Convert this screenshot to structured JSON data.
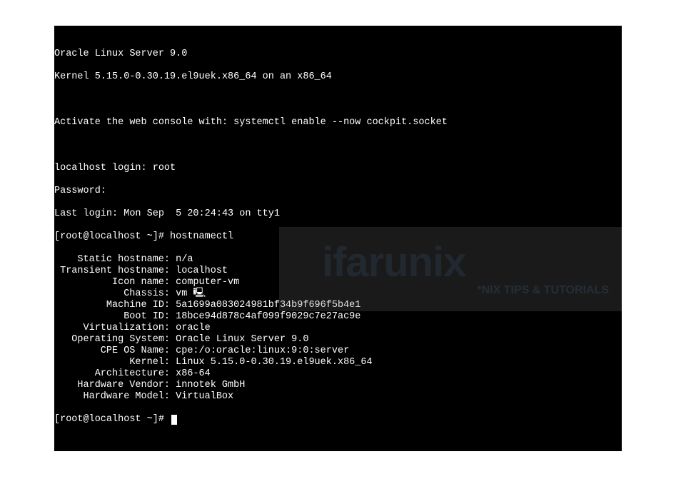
{
  "banner": {
    "line1": "Oracle Linux Server 9.0",
    "line2": "Kernel 5.15.0-0.30.19.el9uek.x86_64 on an x86_64",
    "activate": "Activate the web console with: systemctl enable --now cockpit.socket"
  },
  "login": {
    "prompt_label": "localhost login: ",
    "username": "root",
    "password_label": "Password:",
    "last_login": "Last login: Mon Sep  5 20:24:43 on tty1"
  },
  "shell": {
    "prompt1": "[root@localhost ~]# ",
    "command1": "hostnamectl",
    "prompt2": "[root@localhost ~]# "
  },
  "hostnamectl": [
    {
      "label": "Static hostname",
      "value": "n/a"
    },
    {
      "label": "Transient hostname",
      "value": "localhost"
    },
    {
      "label": "Icon name",
      "value": "computer-vm"
    },
    {
      "label": "Chassis",
      "value": "vm 🖳"
    },
    {
      "label": "Machine ID",
      "value": "5a1699a083024981bf34b9f696f5b4e1"
    },
    {
      "label": "Boot ID",
      "value": "18bce94d878c4af099f9029c7e27ac9e"
    },
    {
      "label": "Virtualization",
      "value": "oracle"
    },
    {
      "label": "Operating System",
      "value": "Oracle Linux Server 9.0"
    },
    {
      "label": "CPE OS Name",
      "value": "cpe:/o:oracle:linux:9:0:server"
    },
    {
      "label": "Kernel",
      "value": "Linux 5.15.0-0.30.19.el9uek.x86_64"
    },
    {
      "label": "Architecture",
      "value": "x86-64"
    },
    {
      "label": "Hardware Vendor",
      "value": "innotek GmbH"
    },
    {
      "label": "Hardware Model",
      "value": "VirtualBox"
    }
  ],
  "watermark": {
    "main": "ifarunix",
    "sub": "*NIX TIPS & TUTORIALS"
  }
}
